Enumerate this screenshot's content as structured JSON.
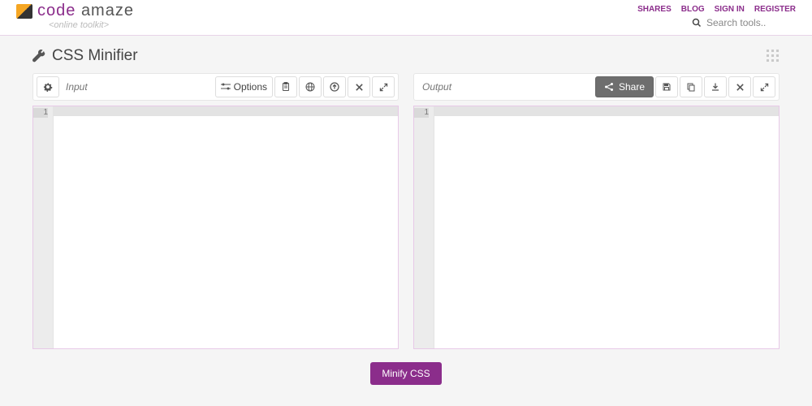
{
  "header": {
    "brand_code": "code",
    "brand_amaze": "amaze",
    "subtitle": "<online toolkit>",
    "links": [
      "SHARES",
      "BLOG",
      "SIGN IN",
      "REGISTER"
    ],
    "search_placeholder": "Search tools.."
  },
  "page": {
    "title": "CSS Minifier"
  },
  "input_panel": {
    "placeholder": "Input",
    "options_label": "Options",
    "line_number": "1"
  },
  "output_panel": {
    "placeholder": "Output",
    "share_label": "Share",
    "line_number": "1"
  },
  "actions": {
    "minify": "Minify CSS"
  }
}
